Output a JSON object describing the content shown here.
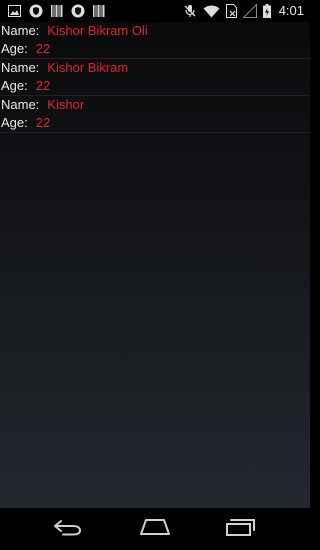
{
  "status_bar": {
    "time": "4:01",
    "icons_left": [
      "image-notification-icon",
      "shield-notification-icon",
      "barcode-notification-icon",
      "shield-notification-icon",
      "barcode-notification-icon"
    ],
    "icons_right": [
      "muted-mic-icon",
      "wifi-icon",
      "sim-card-icon",
      "signal-icon",
      "battery-charging-icon"
    ]
  },
  "list": {
    "items": [
      {
        "name_label": "Name:",
        "name": "Kishor Bikram Oli",
        "age_label": "Age:",
        "age": "22"
      },
      {
        "name_label": "Name:",
        "name": "Kishor Bikram",
        "age_label": "Age:",
        "age": "22"
      },
      {
        "name_label": "Name:",
        "name": "Kishor",
        "age_label": "Age:",
        "age": "22"
      }
    ]
  },
  "nav_bar": {
    "buttons": [
      "back-icon",
      "home-icon",
      "recent-apps-icon"
    ]
  },
  "colors": {
    "label": "#e9e9e9",
    "value": "#e3222a",
    "background_top": "#0a0a0b",
    "background_bottom": "#23282e"
  }
}
